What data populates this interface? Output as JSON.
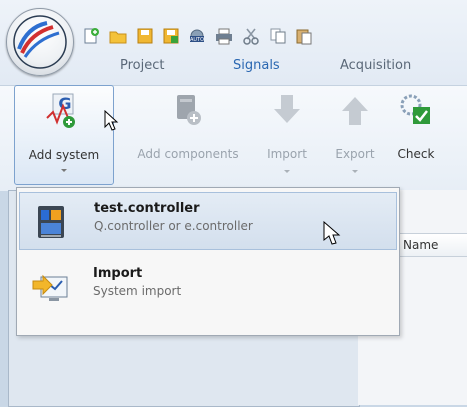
{
  "ribbon": {
    "tabs": [
      {
        "label": "Project",
        "active": false
      },
      {
        "label": "Signals",
        "active": true
      },
      {
        "label": "Acquisition",
        "active": false
      }
    ],
    "buttons": [
      {
        "label": "Add system",
        "icon": "add-system-icon",
        "enabled": true
      },
      {
        "label": "Add components",
        "icon": "add-components-icon",
        "enabled": false
      },
      {
        "label": "Import",
        "icon": "import-arrow-icon",
        "enabled": false
      },
      {
        "label": "Export",
        "icon": "export-arrow-icon",
        "enabled": false
      },
      {
        "label": "Check",
        "icon": "check-icon",
        "enabled": true
      }
    ],
    "quick_access": [
      "new-icon",
      "open-folder-icon",
      "save-icon",
      "save-as-icon",
      "auto-icon",
      "print-icon",
      "cut-icon",
      "copy-icon",
      "paste-icon"
    ]
  },
  "dropdown": {
    "items": [
      {
        "title": "test.controller",
        "subtitle": "Q.controller or e.controller",
        "icon": "controller-icon",
        "highlighted": true
      },
      {
        "title": "Import",
        "subtitle": "System import",
        "icon": "system-import-icon",
        "highlighted": false
      }
    ]
  },
  "table": {
    "column_name": "Name"
  },
  "colors": {
    "active_tab": "#2a67b1",
    "ribbon_bg": "#e7eef6",
    "menu_highlight": "#d3dfed"
  }
}
